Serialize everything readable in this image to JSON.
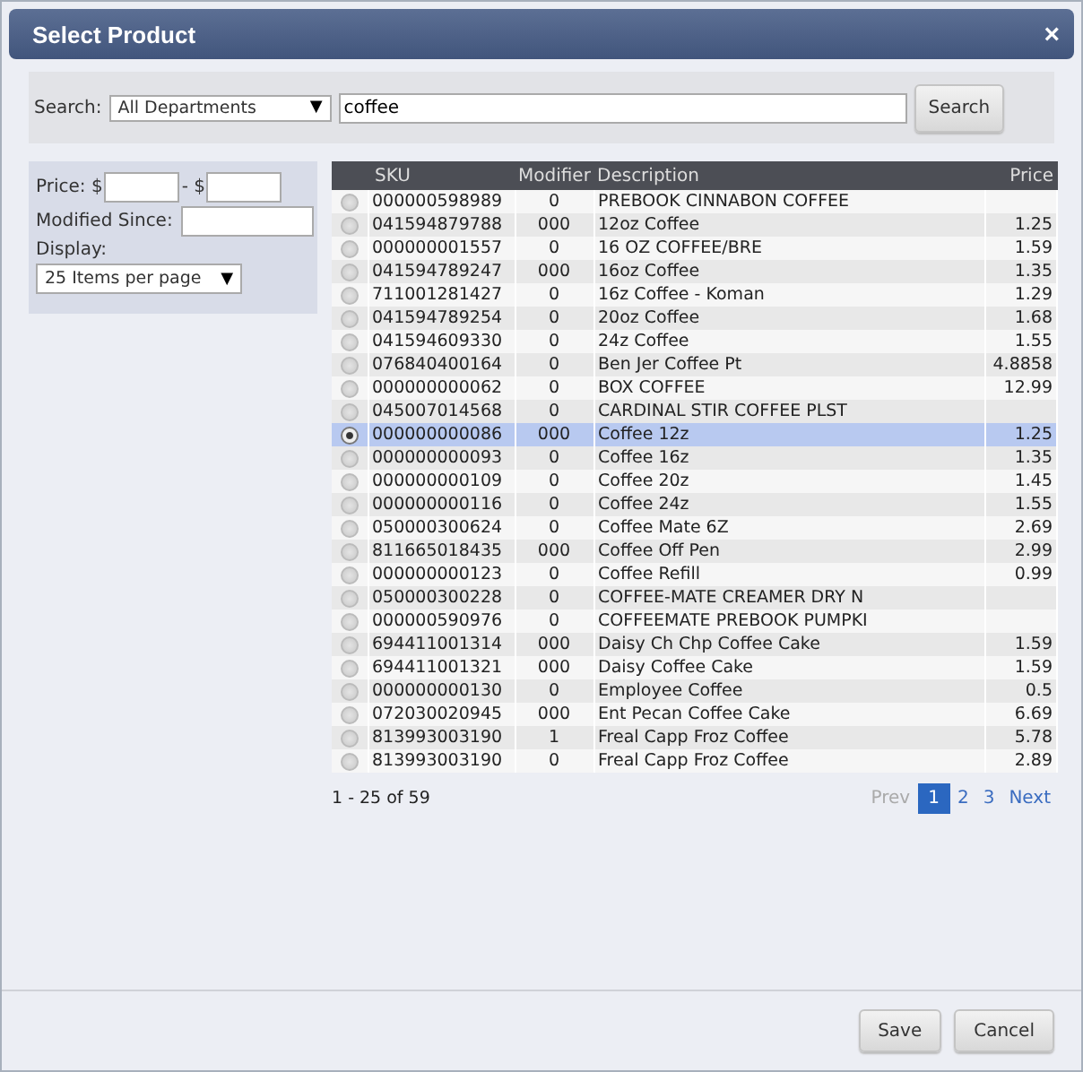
{
  "window": {
    "title": "Select Product",
    "close": "×"
  },
  "search": {
    "label": "Search:",
    "department": "All Departments",
    "caret": "▼",
    "value": "coffee",
    "button": "Search"
  },
  "filters": {
    "price_label": "Price: $",
    "price_sep": "- $",
    "modified_label": "Modified Since:",
    "display_label": "Display:",
    "display_value": "25 Items per page",
    "caret": "▼"
  },
  "table": {
    "columns": [
      "SKU",
      "Modifier",
      "Description",
      "Price"
    ],
    "rows": [
      {
        "sku": "000000598989",
        "modifier": "0",
        "description": "PREBOOK CINNABON COFFEE",
        "price": "",
        "selected": false
      },
      {
        "sku": "041594879788",
        "modifier": "000",
        "description": "12oz Coffee",
        "price": "1.25",
        "selected": false
      },
      {
        "sku": "000000001557",
        "modifier": "0",
        "description": "16 OZ COFFEE/BRE",
        "price": "1.59",
        "selected": false
      },
      {
        "sku": "041594789247",
        "modifier": "000",
        "description": "16oz Coffee",
        "price": "1.35",
        "selected": false
      },
      {
        "sku": "711001281427",
        "modifier": "0",
        "description": "16z Coffee - Koman",
        "price": "1.29",
        "selected": false
      },
      {
        "sku": "041594789254",
        "modifier": "0",
        "description": "20oz Coffee",
        "price": "1.68",
        "selected": false
      },
      {
        "sku": "041594609330",
        "modifier": "0",
        "description": "24z Coffee",
        "price": "1.55",
        "selected": false
      },
      {
        "sku": "076840400164",
        "modifier": "0",
        "description": "Ben Jer Coffee Pt",
        "price": "4.8858",
        "selected": false
      },
      {
        "sku": "000000000062",
        "modifier": "0",
        "description": "BOX COFFEE",
        "price": "12.99",
        "selected": false
      },
      {
        "sku": "045007014568",
        "modifier": "0",
        "description": "CARDINAL STIR COFFEE PLST",
        "price": "",
        "selected": false
      },
      {
        "sku": "000000000086",
        "modifier": "000",
        "description": "Coffee 12z",
        "price": "1.25",
        "selected": true
      },
      {
        "sku": "000000000093",
        "modifier": "0",
        "description": "Coffee 16z",
        "price": "1.35",
        "selected": false
      },
      {
        "sku": "000000000109",
        "modifier": "0",
        "description": "Coffee 20z",
        "price": "1.45",
        "selected": false
      },
      {
        "sku": "000000000116",
        "modifier": "0",
        "description": "Coffee 24z",
        "price": "1.55",
        "selected": false
      },
      {
        "sku": "050000300624",
        "modifier": "0",
        "description": "Coffee Mate 6Z",
        "price": "2.69",
        "selected": false
      },
      {
        "sku": "811665018435",
        "modifier": "000",
        "description": "Coffee Off Pen",
        "price": "2.99",
        "selected": false
      },
      {
        "sku": "000000000123",
        "modifier": "0",
        "description": "Coffee Refill",
        "price": "0.99",
        "selected": false
      },
      {
        "sku": "050000300228",
        "modifier": "0",
        "description": "COFFEE-MATE CREAMER DRY N",
        "price": "",
        "selected": false
      },
      {
        "sku": "000000590976",
        "modifier": "0",
        "description": "COFFEEMATE PREBOOK PUMPKI",
        "price": "",
        "selected": false
      },
      {
        "sku": "694411001314",
        "modifier": "000",
        "description": "Daisy Ch Chp Coffee Cake",
        "price": "1.59",
        "selected": false
      },
      {
        "sku": "694411001321",
        "modifier": "000",
        "description": "Daisy Coffee Cake",
        "price": "1.59",
        "selected": false
      },
      {
        "sku": "000000000130",
        "modifier": "0",
        "description": "Employee Coffee",
        "price": "0.5",
        "selected": false
      },
      {
        "sku": "072030020945",
        "modifier": "000",
        "description": "Ent Pecan Coffee Cake",
        "price": "6.69",
        "selected": false
      },
      {
        "sku": "813993003190",
        "modifier": "1",
        "description": "Freal Capp Froz Coffee",
        "price": "5.78",
        "selected": false
      },
      {
        "sku": "813993003190",
        "modifier": "0",
        "description": "Freal Capp Froz Coffee",
        "price": "2.89",
        "selected": false
      }
    ]
  },
  "footer": {
    "range": "1 - 25 of 59",
    "prev": {
      "label": "Prev",
      "disabled": true
    },
    "pages": [
      {
        "label": "1",
        "selected": true
      },
      {
        "label": "2",
        "selected": false
      },
      {
        "label": "3",
        "selected": false
      }
    ],
    "next": {
      "label": "Next",
      "disabled": false
    }
  },
  "buttons": [
    "Save",
    "Cancel"
  ]
}
